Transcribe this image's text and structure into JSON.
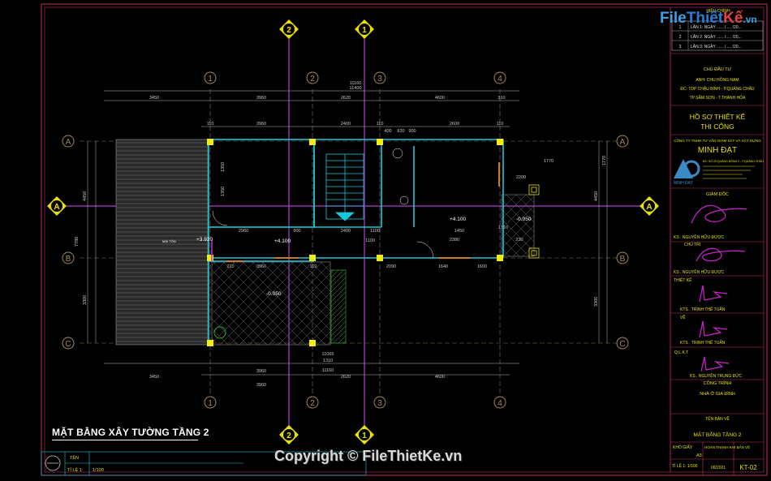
{
  "logo": {
    "file": "File",
    "thiet": "Thiết",
    "ke": "Kế",
    "vn": ".vn"
  },
  "watermark": "Copyright © FileThietKe.vn",
  "drawing_title": "MẶT BẰNG XÂY TƯỜNG TẦNG 2",
  "grid_numbers": [
    "1",
    "2",
    "3",
    "4"
  ],
  "section_markers": [
    "1",
    "2"
  ],
  "grid_letters": [
    "A",
    "B",
    "C"
  ],
  "dims": {
    "overall_top": "11400",
    "total_top": "11160",
    "row1": [
      "3450",
      "3960",
      "2620",
      "4600",
      "310"
    ],
    "row2": [
      "110",
      "3960",
      "2400",
      "110",
      "2600",
      "110"
    ],
    "row3": [
      "400",
      "820",
      "900"
    ],
    "left_side": [
      "4450",
      "1350",
      "1350",
      "7780",
      "3300"
    ],
    "right_side": [
      "1770",
      "4450",
      "3300"
    ],
    "interior_1": [
      "2960",
      "900",
      "2400",
      "1100",
      "1770"
    ],
    "interior_2": [
      "3960",
      "110",
      "2090",
      "1640",
      "1600",
      "2380",
      "230"
    ],
    "interior_3": [
      "210",
      "1710",
      "1450",
      "1100",
      "2200"
    ],
    "bottom": [
      "3450",
      "3960",
      "2620",
      "4600",
      "1310",
      "11065",
      "11160",
      "3960"
    ]
  },
  "levels": {
    "l1": "+4.100",
    "l2": "+4.100",
    "l3": "+3.920",
    "l4": "-0.050",
    "l5": "-0.050"
  },
  "room_label": "MÁI TÔN",
  "title_block": {
    "revision_header": "HIỆU CHỈNH",
    "revisions": [
      {
        "no": "1",
        "text": "LẦN 1: NGÀY ...... /..... /20..."
      },
      {
        "no": "2",
        "text": "LẦN 2: NGÀY ...... /..... /20..."
      },
      {
        "no": "3",
        "text": "LẦN 3: NGÀY ...... /..... /20..."
      }
    ],
    "owner_label": "CHỦ ĐẦU TƯ",
    "owner_name": "ANH: CHU HỒNG NAM",
    "owner_addr1": "ĐC: TDP CHẬU BÌNH - P.QUẢNG CHÂU",
    "owner_addr2": "TP SẦM SƠN - T.THANH HÓA",
    "doc_title1": "HỒ SƠ THIẾT KẾ",
    "doc_title2": "THI CÔNG",
    "company_line": "CÔNG TY TNHH TƯ VẤN GIÁM SÁT VÀ XÂY DỰNG",
    "company_name": "MINH ĐẠT",
    "company_addr": "ĐC: SỐ 20 QUẢNG ĐÔNG 2 - P.QUẢNG CHÂU",
    "logo_name": "MINH ĐẠT",
    "director_label": "GIÁM ĐỐC",
    "director_name": "KS . NGUYỄN HỮU ĐƯỢC",
    "lead_label": "CHỦ TRÌ",
    "lead_name": "KS . NGUYỄN HỮU ĐƯỢC",
    "designer_label": "THIẾT KẾ",
    "designer_name": "KTS . TRỊNH THẾ TUẤN",
    "drafter_label": "VẼ",
    "drafter_name": "KTS . TRỊNH THẾ TUẤN",
    "qa_label": "Q.L.K.T",
    "qa_name": "KS . NGUYỄN TRUNG ĐỨC",
    "project_label": "CÔNG TRÌNH",
    "project_name": "NHÀ Ở GIA ĐÌNH",
    "sheet_label": "TÊN BẢN VẼ",
    "sheet_name": "MẶT BẰNG TẦNG 2",
    "paper_label": "KHỔ GIẤY",
    "paper_value": "A3",
    "done_label": "HOÀN THÀNH KHI BẢN VẼ",
    "scale_label": "TỈ LỆ 1: 1/100",
    "date_value": "06/2021",
    "sheet_no": "KT-02"
  },
  "bottom_left": {
    "name_label": "TÊN",
    "scale_label": "TỈ LỆ 1:",
    "scale_value": "1/100"
  }
}
